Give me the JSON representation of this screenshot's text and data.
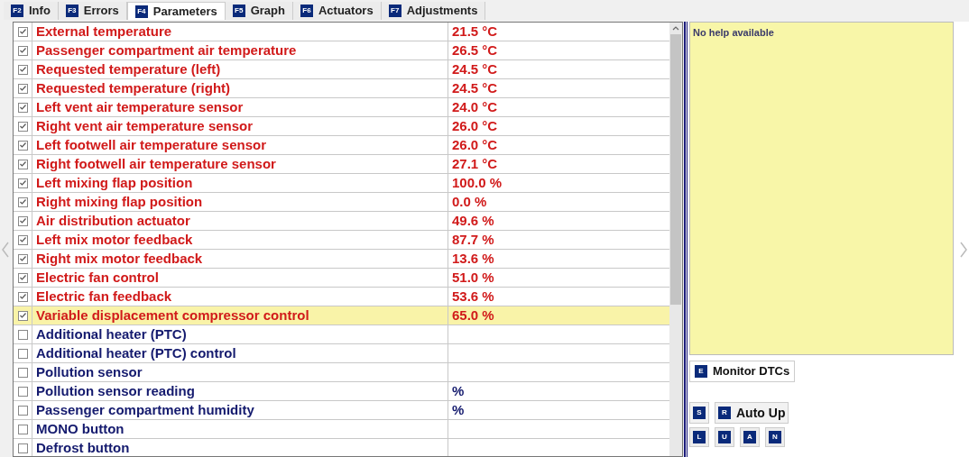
{
  "tabs": [
    {
      "key": "F2",
      "label": "Info",
      "selected": false
    },
    {
      "key": "F3",
      "label": "Errors",
      "selected": false
    },
    {
      "key": "F4",
      "label": "Parameters",
      "selected": true
    },
    {
      "key": "F5",
      "label": "Graph",
      "selected": false
    },
    {
      "key": "F6",
      "label": "Actuators",
      "selected": false
    },
    {
      "key": "F7",
      "label": "Adjustments",
      "selected": false
    }
  ],
  "parameters": [
    {
      "name": "External temperature",
      "value": "21.5 °C",
      "checked": true,
      "selected": false
    },
    {
      "name": "Passenger compartment air temperature",
      "value": "26.5 °C",
      "checked": true,
      "selected": false
    },
    {
      "name": "Requested temperature (left)",
      "value": "24.5 °C",
      "checked": true,
      "selected": false
    },
    {
      "name": "Requested temperature (right)",
      "value": "24.5 °C",
      "checked": true,
      "selected": false
    },
    {
      "name": "Left vent air temperature sensor",
      "value": "24.0 °C",
      "checked": true,
      "selected": false
    },
    {
      "name": "Right vent air temperature sensor",
      "value": "26.0 °C",
      "checked": true,
      "selected": false
    },
    {
      "name": "Left footwell air temperature sensor",
      "value": "26.0 °C",
      "checked": true,
      "selected": false
    },
    {
      "name": "Right footwell air temperature sensor",
      "value": "27.1 °C",
      "checked": true,
      "selected": false
    },
    {
      "name": "Left mixing flap position",
      "value": "100.0 %",
      "checked": true,
      "selected": false
    },
    {
      "name": "Right mixing flap position",
      "value": "0.0 %",
      "checked": true,
      "selected": false
    },
    {
      "name": "Air distribution actuator",
      "value": "49.6 %",
      "checked": true,
      "selected": false
    },
    {
      "name": "Left mix motor feedback",
      "value": "87.7 %",
      "checked": true,
      "selected": false
    },
    {
      "name": "Right mix motor feedback",
      "value": "13.6 %",
      "checked": true,
      "selected": false
    },
    {
      "name": "Electric fan control",
      "value": "51.0 %",
      "checked": true,
      "selected": false
    },
    {
      "name": "Electric fan feedback",
      "value": "53.6 %",
      "checked": true,
      "selected": false
    },
    {
      "name": "Variable displacement compressor control",
      "value": "65.0 %",
      "checked": true,
      "selected": true
    },
    {
      "name": "Additional heater (PTC)",
      "checked": false,
      "selected": false
    },
    {
      "name": "Additional heater (PTC) control",
      "checked": false,
      "selected": false
    },
    {
      "name": "Pollution sensor",
      "checked": false,
      "selected": false
    },
    {
      "name": "Pollution sensor reading",
      "value": "%",
      "checked": false,
      "selected": false
    },
    {
      "name": "Passenger compartment humidity",
      "value": "%",
      "checked": false,
      "selected": false
    },
    {
      "name": "MONO button",
      "checked": false,
      "selected": false
    },
    {
      "name": "Defrost button",
      "checked": false,
      "selected": false
    }
  ],
  "help": {
    "text": "No help available"
  },
  "monitor_button": {
    "key": "E",
    "label": "Monitor DTCs"
  },
  "auto_up_keys": [
    {
      "key": "S"
    },
    {
      "key": "R",
      "label": "Auto Up"
    }
  ],
  "small_keys": [
    "L",
    "U",
    "A",
    "N"
  ]
}
